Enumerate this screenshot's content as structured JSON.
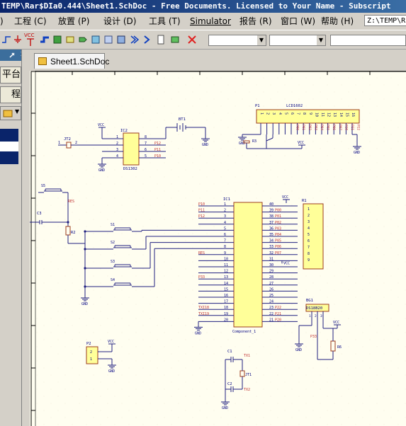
{
  "window": {
    "title": "TEMP\\Rar$DIa0.444\\Sheet1.SchDoc - Free Documents. Licensed to Your Name - Subscript"
  },
  "menu": {
    "items": [
      "工程 (C)",
      "放置 (P)",
      "设计 (D)",
      "工具 (T)",
      "Simulator",
      "报告 (R)",
      "窗口 (W)",
      "帮助 (H)"
    ],
    "path": "Z:\\TEMP\\R"
  },
  "toolbar": {
    "icons": [
      "wire-icon",
      "gnd-icon",
      "vcc-icon",
      "bus-icon",
      "part-icon",
      "sheet-symbol-icon",
      "port-icon",
      "harness-icon",
      "netlabel-icon",
      "directive-icon",
      "noerc-icon",
      "delete-icon"
    ],
    "vcc_label": "VCC"
  },
  "left_panel": {
    "button1": "平台",
    "button2": "程"
  },
  "tabs": [
    {
      "label": "Sheet1.SchDoc"
    }
  ],
  "schematic": {
    "lcd": {
      "designator": "P1",
      "name": "LCD1602",
      "pins": [
        "1",
        "2",
        "3",
        "4",
        "5",
        "6",
        "7",
        "8",
        "9",
        "10",
        "11",
        "12",
        "13",
        "14",
        "15",
        "16"
      ],
      "nets": [
        "P00",
        "P01",
        "P02",
        "P03",
        "P04",
        "P05",
        "P06",
        "P07",
        "P20",
        "P21",
        "P22"
      ]
    },
    "rtc": {
      "designator": "IC2",
      "name": "DS1302",
      "left_pins": [
        "1",
        "2",
        "3",
        "4"
      ],
      "right_pins": [
        "8",
        "7",
        "6",
        "5"
      ],
      "right_nets": [
        "P12",
        "P11",
        "P10"
      ]
    },
    "crystal": {
      "designator": "JT2",
      "pin1": "1",
      "pin2": "2"
    },
    "battery": {
      "designator": "BT1"
    },
    "pot": {
      "designator": "R3"
    },
    "mcu": {
      "designator": "IC1",
      "name": "Component_1",
      "left_nets": [
        "P10",
        "P11",
        "P12",
        "",
        "",
        "",
        "",
        "",
        "RES",
        "",
        "",
        "",
        "P33",
        "",
        "",
        "",
        "",
        "TXI18",
        "TXI19",
        ""
      ],
      "left_pins": [
        "1",
        "2",
        "3",
        "4",
        "5",
        "6",
        "7",
        "8",
        "9",
        "10",
        "11",
        "12",
        "13",
        "14",
        "15",
        "16",
        "17",
        "18",
        "19",
        "20"
      ],
      "right_pins": [
        "40",
        "39",
        "38",
        "37",
        "36",
        "35",
        "34",
        "33",
        "32",
        "31",
        "30",
        "29",
        "28",
        "27",
        "26",
        "25",
        "24",
        "23",
        "22",
        "21"
      ],
      "right_nets": [
        "",
        "P00",
        "P01",
        "P02",
        "P03",
        "P04",
        "P05",
        "P06",
        "P07",
        "",
        "",
        "",
        "",
        "",
        "",
        "",
        "",
        "P22",
        "P21",
        "P20"
      ]
    },
    "pullup": {
      "designator": "R1",
      "pins": [
        "1",
        "2",
        "3",
        "4",
        "5",
        "6",
        "7",
        "8",
        "9"
      ]
    },
    "switches": [
      "S5",
      "S1",
      "S2",
      "S3",
      "S4"
    ],
    "reset": {
      "cap": "C3",
      "res": "R2",
      "net": "RES"
    },
    "header": {
      "designator": "P2",
      "pins": [
        "2",
        "1"
      ]
    },
    "osc": {
      "c1": "C1",
      "c2": "C2",
      "x": "TX1",
      "x2": "TX2",
      "xtal": "JT1"
    },
    "sensor": {
      "designator": "BG1",
      "name": "DS18B20",
      "net": "P33",
      "res": "R6",
      "pins": [
        "1",
        "2",
        "3"
      ]
    },
    "power": {
      "vcc": "VCC",
      "gnd": "GND"
    }
  }
}
